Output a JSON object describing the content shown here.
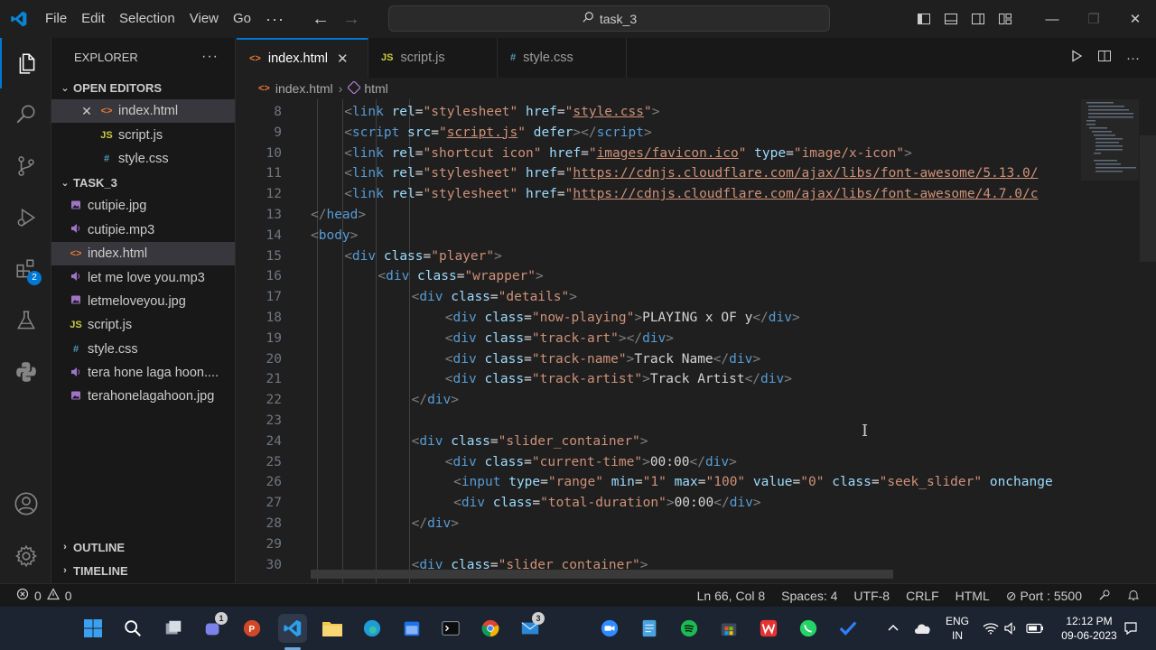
{
  "titlebar": {
    "menu": [
      "File",
      "Edit",
      "Selection",
      "View",
      "Go"
    ],
    "more": "···",
    "search": "task_3"
  },
  "sidebar": {
    "title": "EXPLORER",
    "more": "···",
    "open_editors_label": "OPEN EDITORS",
    "open_editors": [
      {
        "icon": "<>",
        "name": "index.html",
        "selected": true
      },
      {
        "icon": "JS",
        "name": "script.js"
      },
      {
        "icon": "#",
        "name": "style.css"
      }
    ],
    "folder_label": "TASK_3",
    "files": [
      {
        "icon": "img",
        "name": "cutipie.jpg"
      },
      {
        "icon": "audio",
        "name": "cutipie.mp3"
      },
      {
        "icon": "<>",
        "name": "index.html",
        "selected": true
      },
      {
        "icon": "audio",
        "name": "let me love you.mp3"
      },
      {
        "icon": "img",
        "name": "letmeloveyou.jpg"
      },
      {
        "icon": "JS",
        "name": "script.js"
      },
      {
        "icon": "#",
        "name": "style.css"
      },
      {
        "icon": "audio",
        "name": "tera hone laga hoon...."
      },
      {
        "icon": "img",
        "name": "terahonelagahoon.jpg"
      }
    ],
    "outline_label": "OUTLINE",
    "timeline_label": "TIMELINE"
  },
  "activity": {
    "extensions_badge": "2"
  },
  "tabs": [
    {
      "icon": "<>",
      "label": "index.html",
      "active": true
    },
    {
      "icon": "JS",
      "label": "script.js"
    },
    {
      "icon": "#",
      "label": "style.css"
    }
  ],
  "breadcrumb": {
    "file": "index.html",
    "node": "html"
  },
  "code_lines": [
    {
      "n": "8",
      "indent": 1,
      "tokens": [
        [
          "b",
          "<"
        ],
        [
          "t",
          "link"
        ],
        [
          "a",
          " rel"
        ],
        [
          "x",
          "="
        ],
        [
          "s",
          "\"stylesheet\""
        ],
        [
          "a",
          " href"
        ],
        [
          "x",
          "="
        ],
        [
          "s",
          "\""
        ],
        [
          "l",
          "style.css"
        ],
        [
          "s",
          "\""
        ],
        [
          "b",
          ">"
        ]
      ]
    },
    {
      "n": "9",
      "indent": 1,
      "tokens": [
        [
          "b",
          "<"
        ],
        [
          "t",
          "script"
        ],
        [
          "a",
          " src"
        ],
        [
          "x",
          "="
        ],
        [
          "s",
          "\""
        ],
        [
          "l",
          "script.js"
        ],
        [
          "s",
          "\""
        ],
        [
          "a",
          " defer"
        ],
        [
          "b",
          "></"
        ],
        [
          "t",
          "script"
        ],
        [
          "b",
          ">"
        ]
      ]
    },
    {
      "n": "10",
      "indent": 1,
      "tokens": [
        [
          "b",
          "<"
        ],
        [
          "t",
          "link"
        ],
        [
          "a",
          " rel"
        ],
        [
          "x",
          "="
        ],
        [
          "s",
          "\"shortcut icon\""
        ],
        [
          "a",
          " href"
        ],
        [
          "x",
          "="
        ],
        [
          "s",
          "\""
        ],
        [
          "l",
          "images/favicon.ico"
        ],
        [
          "s",
          "\""
        ],
        [
          "a",
          " type"
        ],
        [
          "x",
          "="
        ],
        [
          "s",
          "\"image/x-icon\""
        ],
        [
          "b",
          ">"
        ]
      ]
    },
    {
      "n": "11",
      "indent": 1,
      "tokens": [
        [
          "b",
          "<"
        ],
        [
          "t",
          "link"
        ],
        [
          "a",
          " rel"
        ],
        [
          "x",
          "="
        ],
        [
          "s",
          "\"stylesheet\""
        ],
        [
          "a",
          " href"
        ],
        [
          "x",
          "="
        ],
        [
          "s",
          "\""
        ],
        [
          "l",
          "https://cdnjs.cloudflare.com/ajax/libs/font-awesome/5.13.0/"
        ]
      ]
    },
    {
      "n": "12",
      "indent": 1,
      "tokens": [
        [
          "b",
          "<"
        ],
        [
          "t",
          "link"
        ],
        [
          "a",
          " rel"
        ],
        [
          "x",
          "="
        ],
        [
          "s",
          "\"stylesheet\""
        ],
        [
          "a",
          " href"
        ],
        [
          "x",
          "="
        ],
        [
          "s",
          "\""
        ],
        [
          "l",
          "https://cdnjs.cloudflare.com/ajax/libs/font-awesome/4.7.0/c"
        ]
      ]
    },
    {
      "n": "13",
      "indent": 0,
      "tokens": [
        [
          "b",
          "</"
        ],
        [
          "t",
          "head"
        ],
        [
          "b",
          ">"
        ]
      ]
    },
    {
      "n": "14",
      "indent": 0,
      "tokens": [
        [
          "b",
          "<"
        ],
        [
          "t",
          "body"
        ],
        [
          "b",
          ">"
        ]
      ]
    },
    {
      "n": "15",
      "indent": 1,
      "tokens": [
        [
          "b",
          "<"
        ],
        [
          "t",
          "div"
        ],
        [
          "a",
          " class"
        ],
        [
          "x",
          "="
        ],
        [
          "s",
          "\"player\""
        ],
        [
          "b",
          ">"
        ]
      ]
    },
    {
      "n": "16",
      "indent": 2,
      "tokens": [
        [
          "b",
          "<"
        ],
        [
          "t",
          "div"
        ],
        [
          "a",
          " class"
        ],
        [
          "x",
          "="
        ],
        [
          "s",
          "\"wrapper\""
        ],
        [
          "b",
          ">"
        ]
      ]
    },
    {
      "n": "17",
      "indent": 3,
      "tokens": [
        [
          "b",
          "<"
        ],
        [
          "t",
          "div"
        ],
        [
          "a",
          " class"
        ],
        [
          "x",
          "="
        ],
        [
          "s",
          "\"details\""
        ],
        [
          "b",
          ">"
        ]
      ]
    },
    {
      "n": "18",
      "indent": 4,
      "tokens": [
        [
          "b",
          "<"
        ],
        [
          "t",
          "div"
        ],
        [
          "a",
          " class"
        ],
        [
          "x",
          "="
        ],
        [
          "s",
          "\"now-playing\""
        ],
        [
          "b",
          ">"
        ],
        [
          "x",
          "PLAYING x OF y"
        ],
        [
          "b",
          "</"
        ],
        [
          "t",
          "div"
        ],
        [
          "b",
          ">"
        ]
      ]
    },
    {
      "n": "19",
      "indent": 4,
      "tokens": [
        [
          "b",
          "<"
        ],
        [
          "t",
          "div"
        ],
        [
          "a",
          " class"
        ],
        [
          "x",
          "="
        ],
        [
          "s",
          "\"track-art\""
        ],
        [
          "b",
          "></"
        ],
        [
          "t",
          "div"
        ],
        [
          "b",
          ">"
        ]
      ]
    },
    {
      "n": "20",
      "indent": 4,
      "tokens": [
        [
          "b",
          "<"
        ],
        [
          "t",
          "div"
        ],
        [
          "a",
          " class"
        ],
        [
          "x",
          "="
        ],
        [
          "s",
          "\"track-name\""
        ],
        [
          "b",
          ">"
        ],
        [
          "x",
          "Track Name"
        ],
        [
          "b",
          "</"
        ],
        [
          "t",
          "div"
        ],
        [
          "b",
          ">"
        ]
      ]
    },
    {
      "n": "21",
      "indent": 4,
      "tokens": [
        [
          "b",
          "<"
        ],
        [
          "t",
          "div"
        ],
        [
          "a",
          " class"
        ],
        [
          "x",
          "="
        ],
        [
          "s",
          "\"track-artist\""
        ],
        [
          "b",
          ">"
        ],
        [
          "x",
          "Track Artist"
        ],
        [
          "b",
          "</"
        ],
        [
          "t",
          "div"
        ],
        [
          "b",
          ">"
        ]
      ]
    },
    {
      "n": "22",
      "indent": 3,
      "tokens": [
        [
          "b",
          "</"
        ],
        [
          "t",
          "div"
        ],
        [
          "b",
          ">"
        ]
      ]
    },
    {
      "n": "23",
      "indent": 0,
      "tokens": []
    },
    {
      "n": "24",
      "indent": 3,
      "tokens": [
        [
          "b",
          "<"
        ],
        [
          "t",
          "div"
        ],
        [
          "a",
          " class"
        ],
        [
          "x",
          "="
        ],
        [
          "s",
          "\"slider_container\""
        ],
        [
          "b",
          ">"
        ]
      ]
    },
    {
      "n": "25",
      "indent": 4,
      "tokens": [
        [
          "b",
          "<"
        ],
        [
          "t",
          "div"
        ],
        [
          "a",
          " class"
        ],
        [
          "x",
          "="
        ],
        [
          "s",
          "\"current-time\""
        ],
        [
          "b",
          ">"
        ],
        [
          "x",
          "00:00"
        ],
        [
          "b",
          "</"
        ],
        [
          "t",
          "div"
        ],
        [
          "b",
          ">"
        ]
      ]
    },
    {
      "n": "26",
      "indent": 4.25,
      "tokens": [
        [
          "b",
          "<"
        ],
        [
          "t",
          "input"
        ],
        [
          "a",
          " type"
        ],
        [
          "x",
          "="
        ],
        [
          "s",
          "\"range\""
        ],
        [
          "a",
          " min"
        ],
        [
          "x",
          "="
        ],
        [
          "s",
          "\"1\""
        ],
        [
          "a",
          " max"
        ],
        [
          "x",
          "="
        ],
        [
          "s",
          "\"100\""
        ],
        [
          "a",
          " value"
        ],
        [
          "x",
          "="
        ],
        [
          "s",
          "\"0\""
        ],
        [
          "a",
          " class"
        ],
        [
          "x",
          "="
        ],
        [
          "s",
          "\"seek_slider\""
        ],
        [
          "a",
          " onchange"
        ]
      ]
    },
    {
      "n": "27",
      "indent": 4.25,
      "tokens": [
        [
          "b",
          "<"
        ],
        [
          "t",
          "div"
        ],
        [
          "a",
          " class"
        ],
        [
          "x",
          "="
        ],
        [
          "s",
          "\"total-duration\""
        ],
        [
          "b",
          ">"
        ],
        [
          "x",
          "00:00"
        ],
        [
          "b",
          "</"
        ],
        [
          "t",
          "div"
        ],
        [
          "b",
          ">"
        ]
      ]
    },
    {
      "n": "28",
      "indent": 3,
      "tokens": [
        [
          "b",
          "</"
        ],
        [
          "t",
          "div"
        ],
        [
          "b",
          ">"
        ]
      ]
    },
    {
      "n": "29",
      "indent": 0,
      "tokens": []
    },
    {
      "n": "30",
      "indent": 3,
      "tokens": [
        [
          "b",
          "<"
        ],
        [
          "t",
          "div"
        ],
        [
          "a",
          " class"
        ],
        [
          "x",
          "="
        ],
        [
          "s",
          "\"slider_container\""
        ],
        [
          "b",
          ">"
        ]
      ]
    }
  ],
  "status": {
    "errors": "0",
    "warnings": "0",
    "position": "Ln 66, Col 8",
    "spaces": "Spaces: 4",
    "encoding": "UTF-8",
    "eol": "CRLF",
    "language": "HTML",
    "port": "Port : 5500"
  },
  "taskbar": {
    "teams_badge": "1",
    "mail_badge": "3",
    "lang_top": "ENG",
    "lang_bottom": "IN",
    "time": "12:12 PM",
    "date": "09-06-2023"
  }
}
